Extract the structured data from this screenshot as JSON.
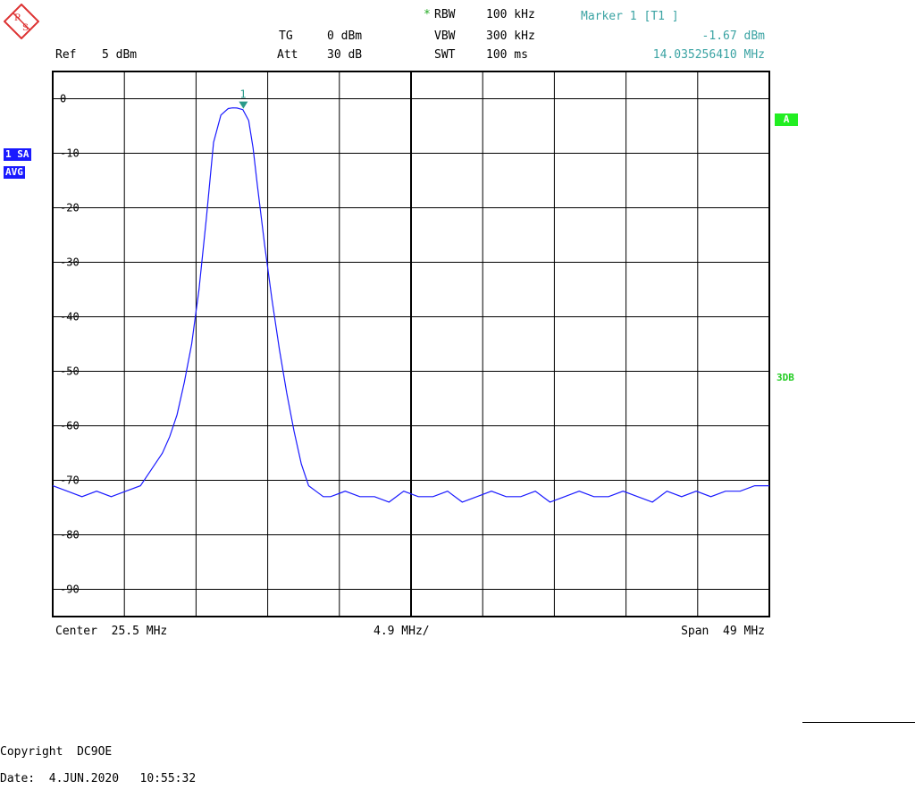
{
  "header": {
    "tg_label": "TG",
    "tg_value": "0 dBm",
    "att_label": "Att",
    "att_value": "30 dB",
    "ref_label": "Ref",
    "ref_value": "5 dBm",
    "rbw_star": "*",
    "rbw_label": "RBW",
    "rbw_value": "100 kHz",
    "vbw_label": "VBW",
    "vbw_value": "300 kHz",
    "swt_label": "SWT",
    "swt_value": "100 ms",
    "marker_title": "Marker 1 [T1 ]",
    "marker_level": "-1.67 dBm",
    "marker_freq": "14.035256410 MHz"
  },
  "badges": {
    "trace": "1 SA",
    "detector": "AVG",
    "a": "A",
    "db3": "3DB"
  },
  "footer": {
    "center": "Center  25.5 MHz",
    "per_div": "4.9 MHz/",
    "span": "Span  49 MHz",
    "copyright": "Copyright  DC9OE",
    "date": "Date:  4.JUN.2020   10:55:32"
  },
  "colors": {
    "trace": "#1a1aff",
    "marker": "#2a9a8a",
    "grid": "#000000",
    "teal_text": "#3aa3a3",
    "green_badge": "#22ee22"
  },
  "chart_data": {
    "type": "line",
    "title": "",
    "xlabel": "",
    "ylabel": "",
    "xlim": [
      1.0,
      50.0
    ],
    "ylim": [
      -95,
      5
    ],
    "y_ticks": [
      0,
      -10,
      -20,
      -30,
      -40,
      -50,
      -60,
      -70,
      -80,
      -90
    ],
    "y_tick_labels": [
      "0",
      "-10",
      "-20",
      "-30",
      "-40",
      "-50",
      "-60",
      "-70",
      "-80",
      "-90"
    ],
    "grid": true,
    "x_unit": "MHz",
    "y_unit": "dBm",
    "series": [
      {
        "x": [
          1.0,
          2.0,
          3.0,
          4.0,
          5.0,
          6.0,
          7.0,
          7.5,
          8.0,
          8.5,
          9.0,
          9.5,
          10.0,
          10.5,
          11.0,
          11.5,
          12.0,
          12.5,
          13.0,
          13.3,
          13.6,
          14.0,
          14.4,
          14.7,
          15.0,
          15.5,
          16.0,
          16.5,
          17.0,
          17.5,
          18.0,
          18.5,
          19.0,
          19.5,
          20.0,
          21.0,
          22.0,
          23.0,
          24.0,
          25.0,
          26.0,
          27.0,
          28.0,
          29.0,
          30.0,
          31.0,
          32.0,
          33.0,
          34.0,
          35.0,
          36.0,
          37.0,
          38.0,
          39.0,
          40.0,
          41.0,
          42.0,
          43.0,
          44.0,
          45.0,
          46.0,
          47.0,
          48.0,
          49.0,
          50.0
        ],
        "y": [
          -71,
          -72,
          -73,
          -72,
          -73,
          -72,
          -71,
          -69,
          -67,
          -65,
          -62,
          -58,
          -52,
          -45,
          -35,
          -22,
          -8,
          -3,
          -1.8,
          -1.67,
          -1.7,
          -2.0,
          -4.0,
          -9.0,
          -16,
          -27,
          -37,
          -46,
          -54,
          -61,
          -67,
          -71,
          -72,
          -73,
          -73,
          -72,
          -73,
          -73,
          -74,
          -72,
          -73,
          -73,
          -72,
          -74,
          -73,
          -72,
          -73,
          -73,
          -72,
          -74,
          -73,
          -72,
          -73,
          -73,
          -72,
          -73,
          -74,
          -72,
          -73,
          -72,
          -73,
          -72,
          -72,
          -71,
          -71
        ]
      }
    ],
    "marker": {
      "label": "1",
      "freq_mhz": 14.03525641,
      "level_dbm": -1.67
    }
  }
}
